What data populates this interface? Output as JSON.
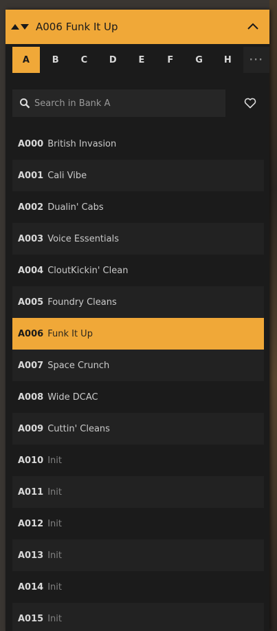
{
  "header": {
    "title_code": "A006",
    "title_name": "Funk It Up",
    "colors": {
      "accent": "#f0a838",
      "background": "#1b1b1b",
      "text": "#d9d9d9"
    }
  },
  "tabs": [
    {
      "label": "A",
      "active": true
    },
    {
      "label": "B",
      "active": false
    },
    {
      "label": "C",
      "active": false
    },
    {
      "label": "D",
      "active": false
    },
    {
      "label": "E",
      "active": false
    },
    {
      "label": "F",
      "active": false
    },
    {
      "label": "G",
      "active": false
    },
    {
      "label": "H",
      "active": false
    },
    {
      "label": "···",
      "active": false
    }
  ],
  "search": {
    "placeholder": "Search in Bank A"
  },
  "presets": [
    {
      "num": "A000",
      "name": "British Invasion"
    },
    {
      "num": "A001",
      "name": "Cali Vibe"
    },
    {
      "num": "A002",
      "name": "Dualin' Cabs"
    },
    {
      "num": "A003",
      "name": "Voice Essentials"
    },
    {
      "num": "A004",
      "name": "CloutKickin' Clean"
    },
    {
      "num": "A005",
      "name": "Foundry Cleans"
    },
    {
      "num": "A006",
      "name": "Funk It Up",
      "selected": true
    },
    {
      "num": "A007",
      "name": "Space Crunch"
    },
    {
      "num": "A008",
      "name": "Wide DCAC"
    },
    {
      "num": "A009",
      "name": "Cuttin' Cleans"
    },
    {
      "num": "A010",
      "name": "Init"
    },
    {
      "num": "A011",
      "name": "Init"
    },
    {
      "num": "A012",
      "name": "Init"
    },
    {
      "num": "A013",
      "name": "Init"
    },
    {
      "num": "A014",
      "name": "Init"
    },
    {
      "num": "A015",
      "name": "Init"
    }
  ]
}
